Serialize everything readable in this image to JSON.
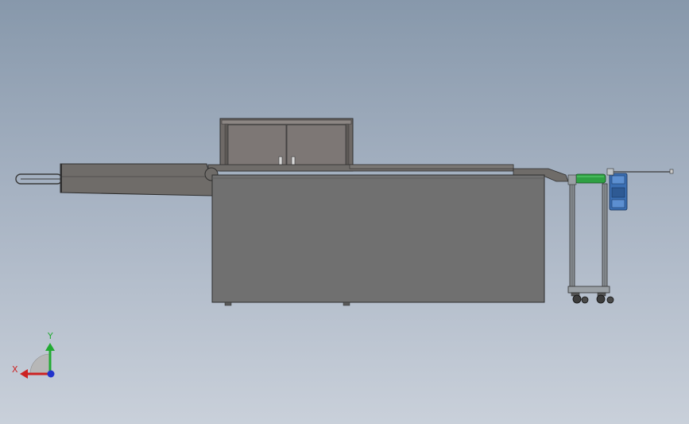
{
  "viewport": {
    "background_top": "#8798ab",
    "background_bottom": "#c9d0da"
  },
  "model": {
    "body_color": "#707070",
    "cabinet_color": "#7d7775",
    "arm_color": "#6f6c69",
    "roller_color": "#2ea043",
    "motor_color": "#3b6fb3"
  },
  "triad": {
    "x_label": "X",
    "y_label": "Y",
    "x_color": "#cc2222",
    "y_color": "#22aa33",
    "z_color": "#2233cc"
  }
}
